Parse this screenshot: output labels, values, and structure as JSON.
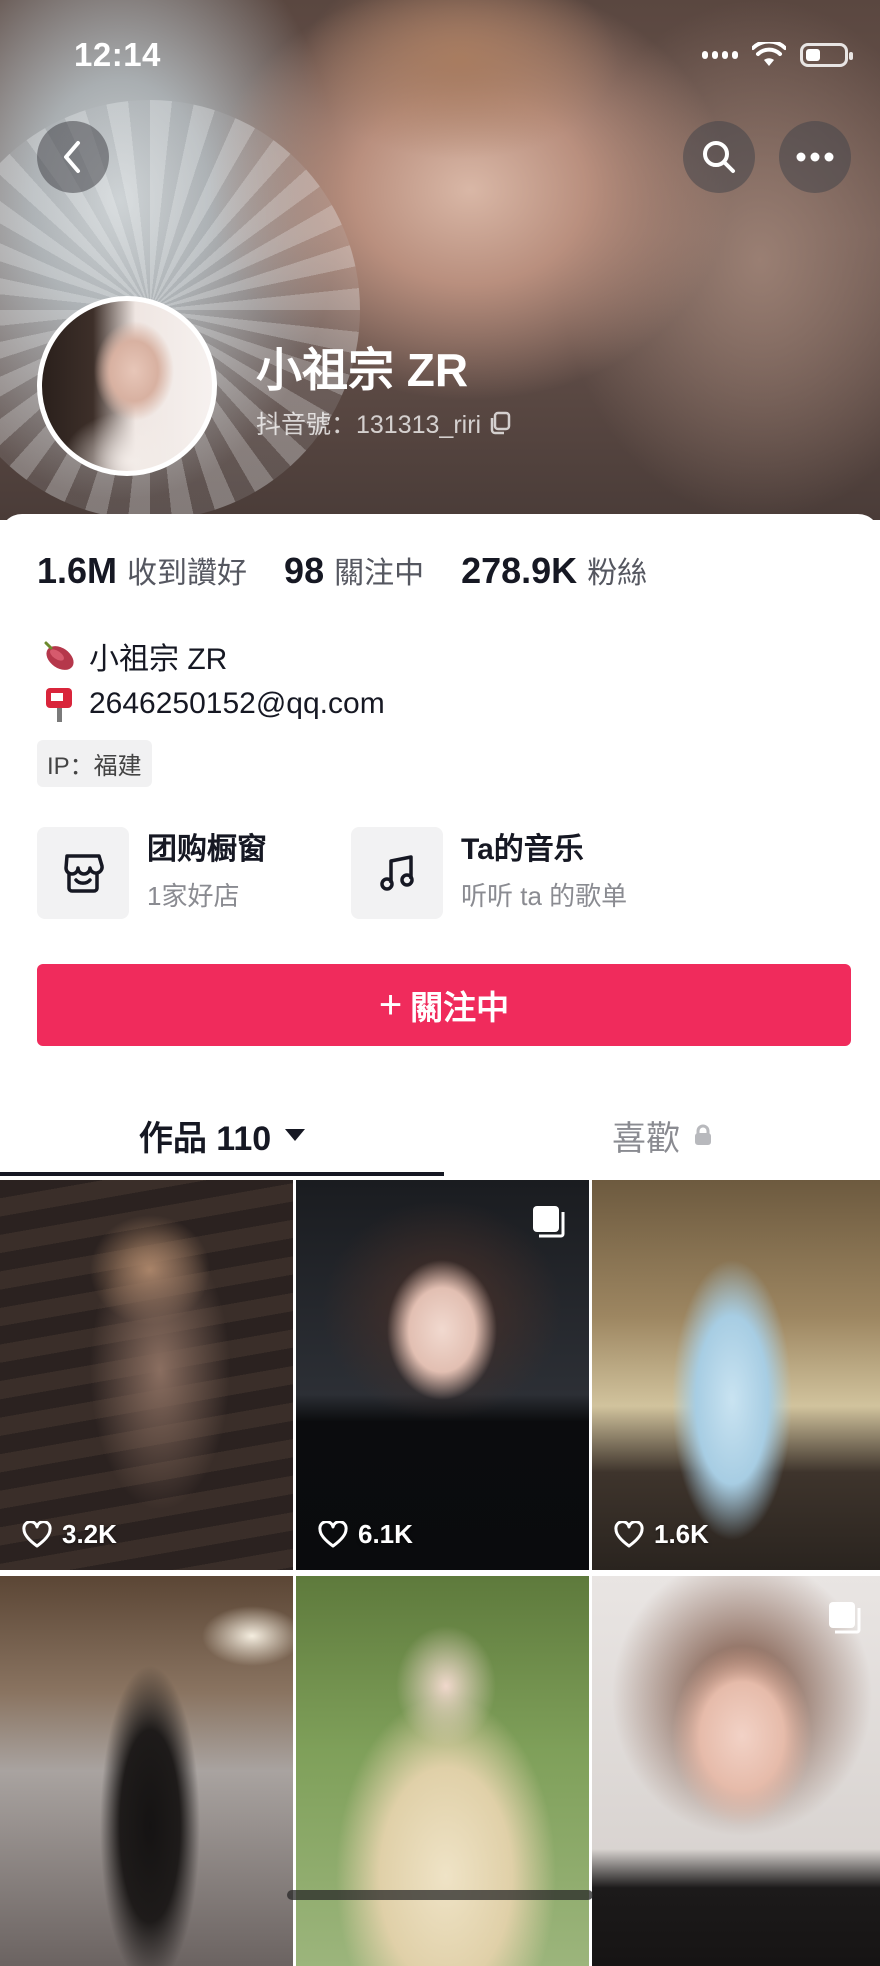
{
  "status_bar": {
    "time": "12:14"
  },
  "header": {
    "display_name": "小祖宗 ZR",
    "douyin_id": "抖音號：131313_riri"
  },
  "stats": [
    {
      "value": "1.6M",
      "label": "收到讚好"
    },
    {
      "value": "98",
      "label": "關注中"
    },
    {
      "value": "278.9K",
      "label": "粉絲"
    }
  ],
  "bio": {
    "line1": "小祖宗 ZR",
    "line2": "2646250152@qq.com",
    "ip": "IP：福建"
  },
  "shortcuts": {
    "shop": {
      "title": "团购橱窗",
      "subtitle": "1家好店"
    },
    "music": {
      "title": "Ta的音乐",
      "subtitle": "听听 ta 的歌单"
    }
  },
  "follow_button": {
    "label": "關注中"
  },
  "tabs": {
    "works": "作品 110",
    "likes": "喜歡"
  },
  "videos": [
    {
      "likes": "3.2K",
      "multi": false
    },
    {
      "likes": "6.1K",
      "multi": true
    },
    {
      "likes": "1.6K",
      "multi": false
    },
    {
      "likes": "",
      "multi": false
    },
    {
      "likes": "",
      "multi": false
    },
    {
      "likes": "",
      "multi": true
    }
  ],
  "colors": {
    "accent": "#f02b5c",
    "text": "#161823",
    "muted": "#8a8b91"
  },
  "icons": [
    "back-icon",
    "search-icon",
    "more-icon",
    "copy-icon",
    "sweet-potato-icon",
    "mailbox-icon",
    "shop-icon",
    "music-note-icon",
    "caret-down-icon",
    "lock-icon",
    "heart-icon",
    "multi-image-icon"
  ]
}
